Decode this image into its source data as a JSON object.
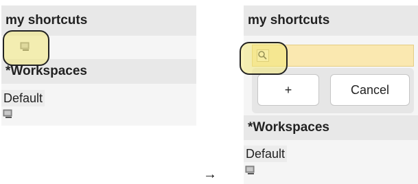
{
  "before": {
    "shortcuts_heading": "my shortcuts",
    "workspaces_heading": "*Workspaces",
    "workspace_item": "Default"
  },
  "after": {
    "shortcuts_heading": "my shortcuts",
    "search_value": "",
    "add_button": "+",
    "cancel_button": "Cancel",
    "workspaces_heading": "*Workspaces",
    "workspace_item": "Default"
  },
  "arrow": "→",
  "icons": {
    "shortcut_icon": "computer-icon",
    "search_icon": "magnifier-icon",
    "workspace_icon": "computer-icon"
  },
  "colors": {
    "highlight": "#f0e678",
    "search_bar": "#fae8b0",
    "header_bg": "#e8e8e8"
  }
}
